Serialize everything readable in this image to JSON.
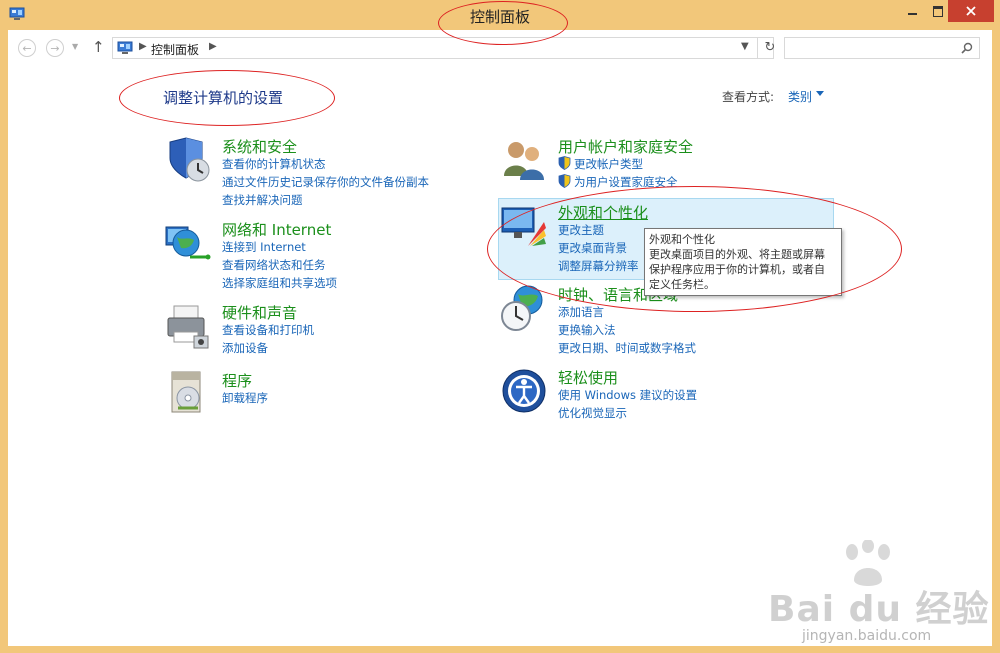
{
  "window": {
    "title": "控制面板"
  },
  "address": {
    "path": "控制面板"
  },
  "page": {
    "heading": "调整计算机的设置"
  },
  "view": {
    "label": "查看方式:",
    "value": "类别"
  },
  "categories": [
    {
      "title": "系统和安全",
      "icon": "shield-clock-icon",
      "links": [
        "查看你的计算机状态",
        "通过文件历史记录保存你的文件备份副本",
        "查找并解决问题"
      ]
    },
    {
      "title": "网络和 Internet",
      "icon": "globe-network-icon",
      "links": [
        "连接到 Internet",
        "查看网络状态和任务",
        "选择家庭组和共享选项"
      ]
    },
    {
      "title": "硬件和声音",
      "icon": "printer-icon",
      "links": [
        "查看设备和打印机",
        "添加设备"
      ]
    },
    {
      "title": "程序",
      "icon": "program-disc-icon",
      "links": [
        "卸载程序"
      ]
    },
    {
      "title": "用户帐户和家庭安全",
      "icon": "users-icon",
      "links": [
        "更改帐户类型",
        "为用户设置家庭安全"
      ]
    },
    {
      "title": "外观和个性化",
      "icon": "appearance-icon",
      "links": [
        "更改主题",
        "更改桌面背景",
        "调整屏幕分辨率"
      ]
    },
    {
      "title": "时钟、语言和区域",
      "icon": "clock-globe-icon",
      "links": [
        "添加语言",
        "更换输入法",
        "更改日期、时间或数字格式"
      ]
    },
    {
      "title": "轻松使用",
      "icon": "ease-of-access-icon",
      "links": [
        "使用 Windows 建议的设置",
        "优化视觉显示"
      ]
    }
  ],
  "tooltip": {
    "title": "外观和个性化",
    "line1": "更改桌面项目的外观、将主题或屏幕",
    "line2": "保护程序应用于你的计算机，或者自",
    "line3": "定义任务栏。"
  },
  "watermark": {
    "logo": "Bai du 经验",
    "url": "jingyan.baidu.com"
  }
}
